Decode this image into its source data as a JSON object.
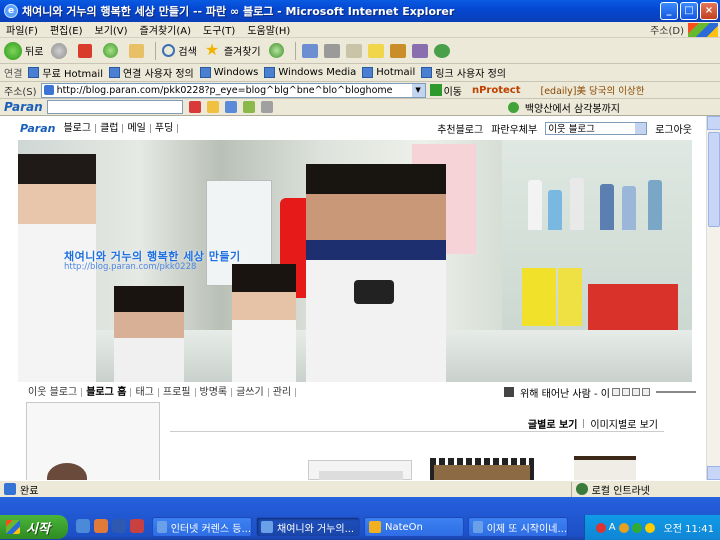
{
  "window": {
    "title": "채여니와 거누의 행복한 세상 만들기 -- 파란 ∞ 블로그 - Microsoft Internet Explorer",
    "min_label": "_",
    "max_label": "□",
    "close_label": "×"
  },
  "menu": {
    "items": [
      "파일(F)",
      "편집(E)",
      "보기(V)",
      "즐겨찾기(A)",
      "도구(T)",
      "도움말(H)"
    ],
    "address_label": "주소(D)"
  },
  "toolbar": {
    "back_label": "뒤로",
    "search_label": "검색",
    "favorites_label": "즐겨찾기"
  },
  "links": {
    "label": "연결",
    "items": [
      "무료 Hotmail",
      "연결 사용자 정의",
      "Windows",
      "Windows Media",
      "Hotmail",
      "링크 사용자 정의"
    ]
  },
  "address": {
    "label": "주소(S)",
    "url": "http://blog.paran.com/pkk0228?p_eye=blog^blg^bne^blo^bloghome",
    "go_label": "이동",
    "nprotect_label": "nProtect",
    "extra_text": "[edaily]美 당국의 이상한"
  },
  "paran_toolbar": {
    "logo": "Paran",
    "news_text": "백양산에서 삼각봉까지"
  },
  "blog": {
    "logo": "Paran",
    "nav": [
      "블로그",
      "클럽",
      "메일",
      "푸딩"
    ],
    "recommend_label": "추천블로그",
    "random_label": "파란우체부",
    "neighbor_select": "이웃 블로그",
    "logout_label": "로그아웃",
    "banner_title": "채여니와 거누의 행복한 세상 만들기",
    "banner_url": "http://blog.paran.com/pkk0228",
    "menu": [
      "이웃 블로그",
      "블로그 홈",
      "태그",
      "프로필",
      "방명록",
      "글쓰기",
      "관리"
    ],
    "music_title": "위해 태어난 사람 - 이",
    "view_text": "글별로 보기",
    "view_image": "이미지별로 보기"
  },
  "status": {
    "text": "완료",
    "zone": "로컬 인트라넷"
  },
  "taskbar": {
    "start_label": "시작",
    "tasks": [
      "인터넷 커렌스 등...",
      "채여니와 거누의...",
      "NateOn",
      "이제 또 시작이네..."
    ],
    "lang": "A",
    "clock": "오전 11:41"
  },
  "colors": {
    "titlebar": "#0548d2",
    "link_blue": "#1e6fe0",
    "start_green": "#3a9f2d"
  }
}
